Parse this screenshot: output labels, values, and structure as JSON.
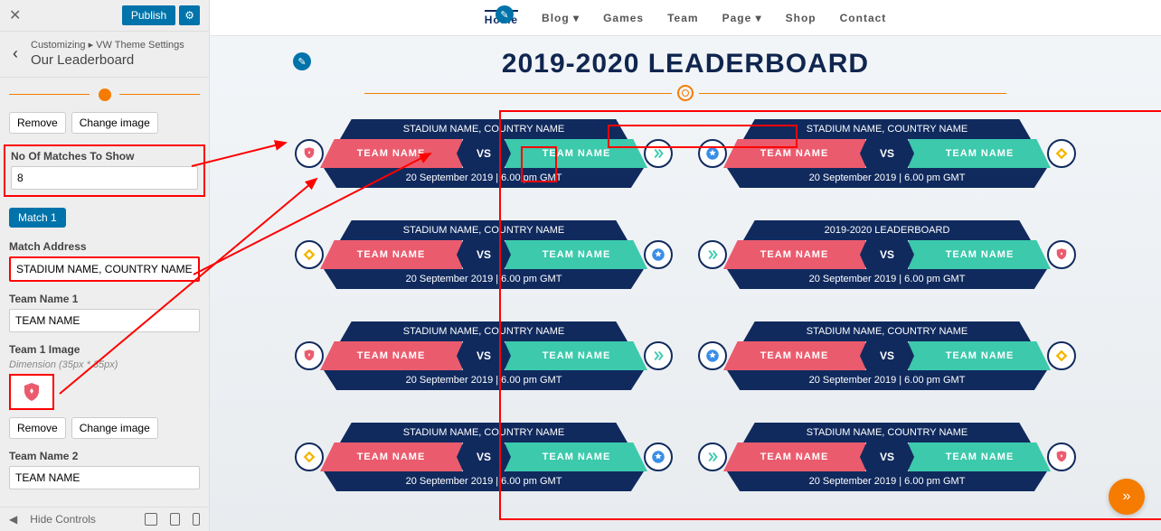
{
  "sidebar": {
    "publish": "Publish",
    "breadcrumb": "Customizing ▸ VW Theme Settings",
    "title": "Our Leaderboard",
    "remove": "Remove",
    "change_image": "Change image",
    "no_matches_label": "No Of Matches To Show",
    "no_matches_value": "8",
    "match_badge": "Match 1",
    "match_address_label": "Match Address",
    "match_address_value": "STADIUM NAME, COUNTRY NAME",
    "team1_label": "Team Name 1",
    "team1_value": "TEAM NAME",
    "team1_image_label": "Team 1 Image",
    "dimension_note": "Dimension (35px * 35px)",
    "team2_label": "Team Name 2",
    "team2_value": "TEAM NAME",
    "hide_controls": "Hide Controls"
  },
  "nav": {
    "home": "Home",
    "blog": "Blog",
    "games": "Games",
    "team": "Team",
    "page": "Page",
    "shop": "Shop",
    "contact": "Contact"
  },
  "leaderboard_title": "2019-2020 LEADERBOARD",
  "vs": "VS",
  "matches": [
    {
      "stadium": "STADIUM NAME, COUNTRY NAME",
      "t1": "TEAM NAME",
      "t2": "TEAM NAME",
      "date": "20 September 2019 | 6.00 pm GMT",
      "i1": "shield-red",
      "i2": "chevrons-teal"
    },
    {
      "stadium": "STADIUM NAME, COUNTRY NAME",
      "t1": "TEAM NAME",
      "t2": "TEAM NAME",
      "date": "20 September 2019 | 6.00 pm GMT",
      "i1": "star-blue",
      "i2": "diamond-yellow"
    },
    {
      "stadium": "STADIUM NAME, COUNTRY NAME",
      "t1": "TEAM NAME",
      "t2": "TEAM NAME",
      "date": "20 September 2019 | 6.00 pm GMT",
      "i1": "diamond-yellow",
      "i2": "star-blue"
    },
    {
      "stadium": "2019-2020 LEADERBOARD",
      "t1": "TEAM NAME",
      "t2": "TEAM NAME",
      "date": "20 September 2019 | 6.00 pm GMT",
      "i1": "chevrons-teal",
      "i2": "shield-red"
    },
    {
      "stadium": "STADIUM NAME, COUNTRY NAME",
      "t1": "TEAM NAME",
      "t2": "TEAM NAME",
      "date": "20 September 2019 | 6.00 pm GMT",
      "i1": "shield-red",
      "i2": "chevrons-teal"
    },
    {
      "stadium": "STADIUM NAME, COUNTRY NAME",
      "t1": "TEAM NAME",
      "t2": "TEAM NAME",
      "date": "20 September 2019 | 6.00 pm GMT",
      "i1": "star-blue",
      "i2": "diamond-yellow"
    },
    {
      "stadium": "STADIUM NAME, COUNTRY NAME",
      "t1": "TEAM NAME",
      "t2": "TEAM NAME",
      "date": "20 September 2019 | 6.00 pm GMT",
      "i1": "diamond-yellow",
      "i2": "star-blue"
    },
    {
      "stadium": "STADIUM NAME, COUNTRY NAME",
      "t1": "TEAM NAME",
      "t2": "TEAM NAME",
      "date": "20 September 2019 | 6.00 pm GMT",
      "i1": "chevrons-teal",
      "i2": "shield-red"
    }
  ]
}
